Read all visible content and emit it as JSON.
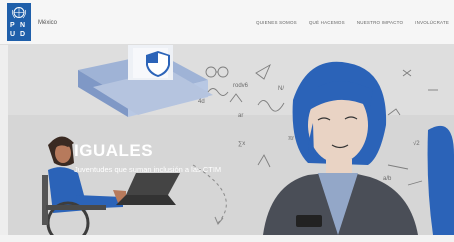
{
  "logo": {
    "letters": [
      "P",
      "N",
      "U",
      "D"
    ],
    "icon": "un-emblem-icon",
    "brand_color": "#1f5faa"
  },
  "header": {
    "country": "México"
  },
  "nav": {
    "items": [
      "QUIENES SOMOS",
      "QUÉ HACEMOS",
      "NUESTRO IMPACTO",
      "INVOLÚCRATE"
    ]
  },
  "hero": {
    "title": "IGUALES",
    "subtitle": "Juventudes que suman inclusión a las CTIM"
  },
  "colors": {
    "accent_blue": "#2b63b8",
    "hero_bg": "#d8d8d8"
  }
}
